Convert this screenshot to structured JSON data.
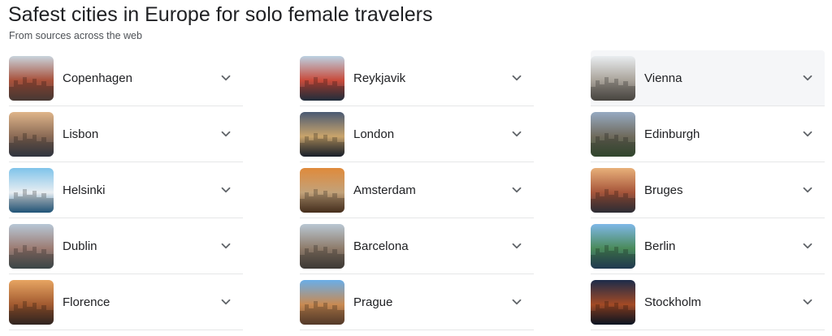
{
  "header": {
    "title": "Safest cities in Europe for solo female travelers",
    "subtitle": "From sources across the web"
  },
  "columns": [
    [
      {
        "name": "Copenhagen",
        "thumb": {
          "sky": "#c9d4dd",
          "mid": "#a8503a",
          "low": "#5b4a44"
        }
      },
      {
        "name": "Lisbon",
        "thumb": {
          "sky": "#dfb58a",
          "mid": "#8a6a55",
          "low": "#3d4452"
        }
      },
      {
        "name": "Helsinki",
        "thumb": {
          "sky": "#7fc3ea",
          "mid": "#e9eef2",
          "low": "#2a6c99"
        }
      },
      {
        "name": "Dublin",
        "thumb": {
          "sky": "#b7c7d6",
          "mid": "#9c7b72",
          "low": "#4c5a5c"
        }
      },
      {
        "name": "Florence",
        "thumb": {
          "sky": "#e7a562",
          "mid": "#a25a30",
          "low": "#3e2f2a"
        }
      }
    ],
    [
      {
        "name": "Reykjavik",
        "thumb": {
          "sky": "#bcd2e3",
          "mid": "#c84a3a",
          "low": "#2b3b4d"
        }
      },
      {
        "name": "London",
        "thumb": {
          "sky": "#4a5a73",
          "mid": "#c9a46b",
          "low": "#1f2735"
        }
      },
      {
        "name": "Amsterdam",
        "thumb": {
          "sky": "#e08a3b",
          "mid": "#c2a27a",
          "low": "#5a3c25"
        }
      },
      {
        "name": "Barcelona",
        "thumb": {
          "sky": "#b9c7d3",
          "mid": "#8e7b6a",
          "low": "#4f4a45"
        }
      },
      {
        "name": "Prague",
        "thumb": {
          "sky": "#6aaee8",
          "mid": "#c98a52",
          "low": "#6b4a35"
        }
      }
    ],
    [
      {
        "name": "Vienna",
        "thumb": {
          "sky": "#e9edf0",
          "mid": "#a9a39a",
          "low": "#5c5852"
        },
        "highlighted": true
      },
      {
        "name": "Edinburgh",
        "thumb": {
          "sky": "#96aac2",
          "mid": "#6f6a5c",
          "low": "#3e5a3a"
        }
      },
      {
        "name": "Bruges",
        "thumb": {
          "sky": "#e8b07a",
          "mid": "#a6553a",
          "low": "#3a3a45"
        }
      },
      {
        "name": "Berlin",
        "thumb": {
          "sky": "#7fb8e8",
          "mid": "#4a8a5a",
          "low": "#2a4a66"
        }
      },
      {
        "name": "Stockholm",
        "thumb": {
          "sky": "#1c2b4a",
          "mid": "#a34a25",
          "low": "#0f1a2c"
        }
      }
    ]
  ],
  "icons": {
    "expand": "chevron-down-icon"
  }
}
